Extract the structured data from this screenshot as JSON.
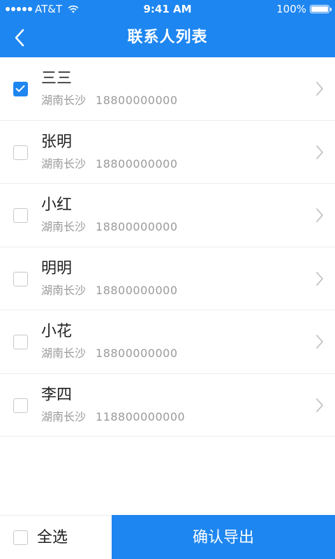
{
  "status_bar": {
    "carrier": "AT&T",
    "time": "9:41 AM",
    "battery": "100%"
  },
  "nav": {
    "title": "联系人列表",
    "back_icon": "chevron-left-icon"
  },
  "contacts": [
    {
      "name": "三三",
      "location": "湖南长沙",
      "phone": "18800000000",
      "checked": true
    },
    {
      "name": "张明",
      "location": "湖南长沙",
      "phone": "18800000000",
      "checked": false
    },
    {
      "name": "小红",
      "location": "湖南长沙",
      "phone": "18800000000",
      "checked": false
    },
    {
      "name": "明明",
      "location": "湖南长沙",
      "phone": "18800000000",
      "checked": false
    },
    {
      "name": "小花",
      "location": "湖南长沙",
      "phone": "18800000000",
      "checked": false
    },
    {
      "name": "李四",
      "location": "湖南长沙",
      "phone": "118800000000",
      "checked": false
    }
  ],
  "bottom": {
    "select_all_label": "全选",
    "select_all_checked": false,
    "export_label": "确认导出"
  },
  "colors": {
    "accent": "#1e86f0",
    "text_primary": "#222222",
    "text_secondary": "#9a9a9a"
  }
}
